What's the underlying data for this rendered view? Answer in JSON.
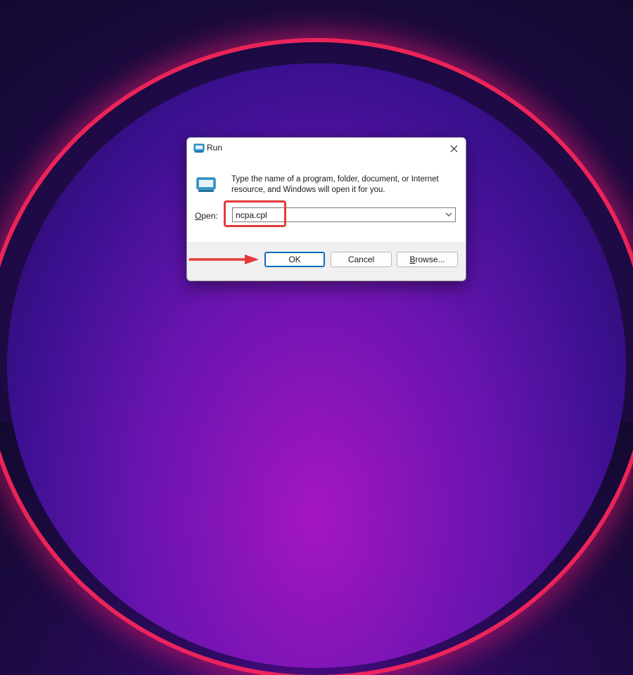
{
  "dialog": {
    "title": "Run",
    "description": "Type the name of a program, folder, document, or Internet resource, and Windows will open it for you.",
    "open_label_underline": "O",
    "open_label_rest": "pen:",
    "input_value": "ncpa.cpl"
  },
  "buttons": {
    "ok": "OK",
    "cancel": "Cancel",
    "browse_underline": "B",
    "browse_rest": "rowse..."
  },
  "icons": {
    "title_icon": "run-icon",
    "close": "close-icon",
    "dropdown": "chevron-down-icon"
  },
  "colors": {
    "annotation": "#e23b3b",
    "ok_border": "#0f6cbd"
  }
}
